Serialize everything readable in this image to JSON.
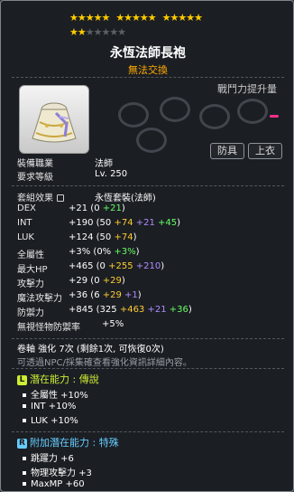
{
  "stars": {
    "row1": [
      "★★★★★",
      "★★★★★",
      "★★★★★"
    ],
    "row2_on": "★★",
    "row2_off": "★★★★★"
  },
  "item": {
    "name": "永恆法師長袍",
    "trade_status": "無法交換",
    "power_label": "戰鬥力提升量",
    "tags": [
      "防具",
      "上衣"
    ]
  },
  "requirements": {
    "job_label": "裝備職業",
    "job_value": "法師",
    "level_label": "要求等級",
    "level_value": "Lv. 250"
  },
  "set": {
    "label": "套組效果",
    "value": "永恆套裝(法師)"
  },
  "stats": [
    {
      "label": "DEX",
      "total": "+21",
      "parts": [
        {
          "t": "(0 ",
          "c": "val"
        },
        {
          "t": "+21",
          "c": "g"
        },
        {
          "t": ")",
          "c": "val"
        }
      ]
    },
    {
      "label": "INT",
      "total": "+190",
      "parts": [
        {
          "t": "(50 ",
          "c": "val"
        },
        {
          "t": "+74",
          "c": "y"
        },
        {
          "t": " +21",
          "c": "b"
        },
        {
          "t": " +45",
          "c": "g"
        },
        {
          "t": ")",
          "c": "val"
        }
      ]
    },
    {
      "label": "LUK",
      "total": "+124",
      "parts": [
        {
          "t": "(50 ",
          "c": "val"
        },
        {
          "t": "+74",
          "c": "y"
        },
        {
          "t": ")",
          "c": "val"
        }
      ]
    },
    {
      "label": "全屬性",
      "total": "+3%",
      "parts": [
        {
          "t": "(0% ",
          "c": "val"
        },
        {
          "t": "+3%",
          "c": "g"
        },
        {
          "t": ")",
          "c": "val"
        }
      ]
    },
    {
      "label": "最大HP",
      "total": "+465",
      "parts": [
        {
          "t": "(0 ",
          "c": "val"
        },
        {
          "t": "+255",
          "c": "y"
        },
        {
          "t": " +210",
          "c": "b"
        },
        {
          "t": ")",
          "c": "val"
        }
      ]
    },
    {
      "label": "攻擊力",
      "total": "+29",
      "parts": [
        {
          "t": "(0 ",
          "c": "val"
        },
        {
          "t": "+29",
          "c": "y"
        },
        {
          "t": ")",
          "c": "val"
        }
      ]
    },
    {
      "label": "魔法攻擊力",
      "total": "+36",
      "parts": [
        {
          "t": "(6 ",
          "c": "val"
        },
        {
          "t": "+29",
          "c": "y"
        },
        {
          "t": " +1",
          "c": "b"
        },
        {
          "t": ")",
          "c": "val"
        }
      ]
    },
    {
      "label": "防禦力",
      "total": "+845",
      "parts": [
        {
          "t": "(325 ",
          "c": "val"
        },
        {
          "t": "+463",
          "c": "y"
        },
        {
          "t": " +21",
          "c": "b"
        },
        {
          "t": " +36",
          "c": "g"
        },
        {
          "t": ")",
          "c": "val"
        }
      ]
    },
    {
      "label": "無視怪物防禦率",
      "total": "+5%",
      "parts": []
    }
  ],
  "scroll": {
    "text": "卷軸 強化 7次 (剩餘1次, 可恢復0次)",
    "hint": "可透過NPC/採集確查看強化資訊詳細內容。"
  },
  "potential": {
    "badge": "L",
    "badge_color": "#ccee33",
    "title": "潛在能力 : 傳說",
    "lines": [
      "全屬性 +10%",
      "INT +10%",
      "LUK +10%"
    ]
  },
  "additional": {
    "badge": "R",
    "badge_color": "#66ccff",
    "title": "附加潛在能力 : 特殊",
    "lines": [
      "跳躍力 +6",
      "物理攻擊力 +3",
      "MaxMP +60"
    ]
  }
}
